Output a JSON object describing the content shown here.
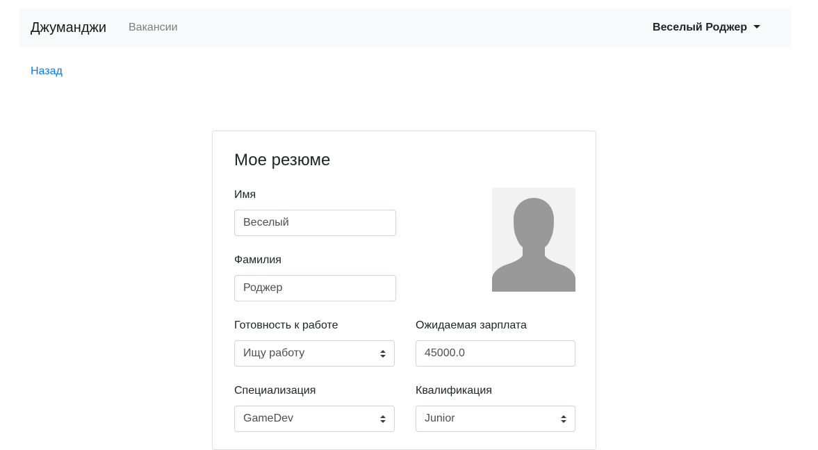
{
  "navbar": {
    "brand": "Джуманджи",
    "vacancies_link": "Вакансии",
    "user_menu": "Веселый Роджер"
  },
  "back_link": "Назад",
  "resume": {
    "title": "Мое резюме",
    "first_name": {
      "label": "Имя",
      "value": "Веселый"
    },
    "last_name": {
      "label": "Фамилия",
      "value": "Роджер"
    },
    "readiness": {
      "label": "Готовность к работе",
      "value": "Ищу работу"
    },
    "salary": {
      "label": "Ожидаемая зарплата",
      "value": "45000.0"
    },
    "specialization": {
      "label": "Специализация",
      "value": "GameDev"
    },
    "qualification": {
      "label": "Квалификация",
      "value": "Junior"
    }
  },
  "colors": {
    "navbar_bg": "#f8f9fa",
    "link": "#007bff",
    "avatar_silhouette": "#999999",
    "avatar_bg": "#f2f2f2"
  },
  "icons": {
    "avatar": "person-silhouette-icon",
    "user_menu_caret": "caret-down-icon",
    "select_arrows": "select-arrows-icon"
  }
}
